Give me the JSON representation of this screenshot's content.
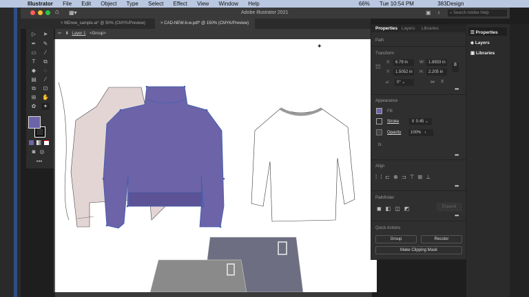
{
  "menubar": {
    "app": "Illustrator",
    "items": [
      "File",
      "Edit",
      "Object",
      "Type",
      "Select",
      "Effect",
      "View",
      "Window",
      "Help"
    ],
    "battery": "66%",
    "clock": "Tue 10:54 PM",
    "user": "383Design"
  },
  "titlebar": {
    "title": "Adobe Illustrator 2021",
    "search_placeholder": "Search Adobe Help"
  },
  "tabs": [
    {
      "label": "MDrew_sample.ai* @ 50% (CMYK/Preview)"
    },
    {
      "label": "CAD-NEW-b-w.pdf* @ 150% (CMYK/Preview)"
    }
  ],
  "control": {
    "layer": "Layer 1",
    "group": "<Group>"
  },
  "colors": {
    "fill": "#6c63a8",
    "accent": "#4a7cc7"
  },
  "props": {
    "tabs": [
      "Properties",
      "Layers",
      "Libraries"
    ],
    "path": "Path",
    "transform": {
      "title": "Transform",
      "x_label": "X:",
      "x": "6.79 in",
      "y_label": "Y:",
      "y": "1.5052 in",
      "w_label": "W:",
      "w": "1.8933 in",
      "h_label": "H:",
      "h": "2.205 in",
      "angle": "0°"
    },
    "appearance": {
      "title": "Appearance",
      "fill": "Fill",
      "stroke": "Stroke",
      "stroke_value": "0.45",
      "opacity": "Opacity",
      "opacity_value": "100%",
      "fx": "fx."
    },
    "align": {
      "title": "Align"
    },
    "pathfinder": {
      "title": "Pathfinder",
      "expand": "Expand"
    },
    "quick": {
      "title": "Quick Actions",
      "group": "Group",
      "recolor": "Recolor",
      "clip": "Make Clipping Mask"
    }
  },
  "rightpanel": {
    "items": [
      "Properties",
      "Layers",
      "Libraries"
    ]
  }
}
